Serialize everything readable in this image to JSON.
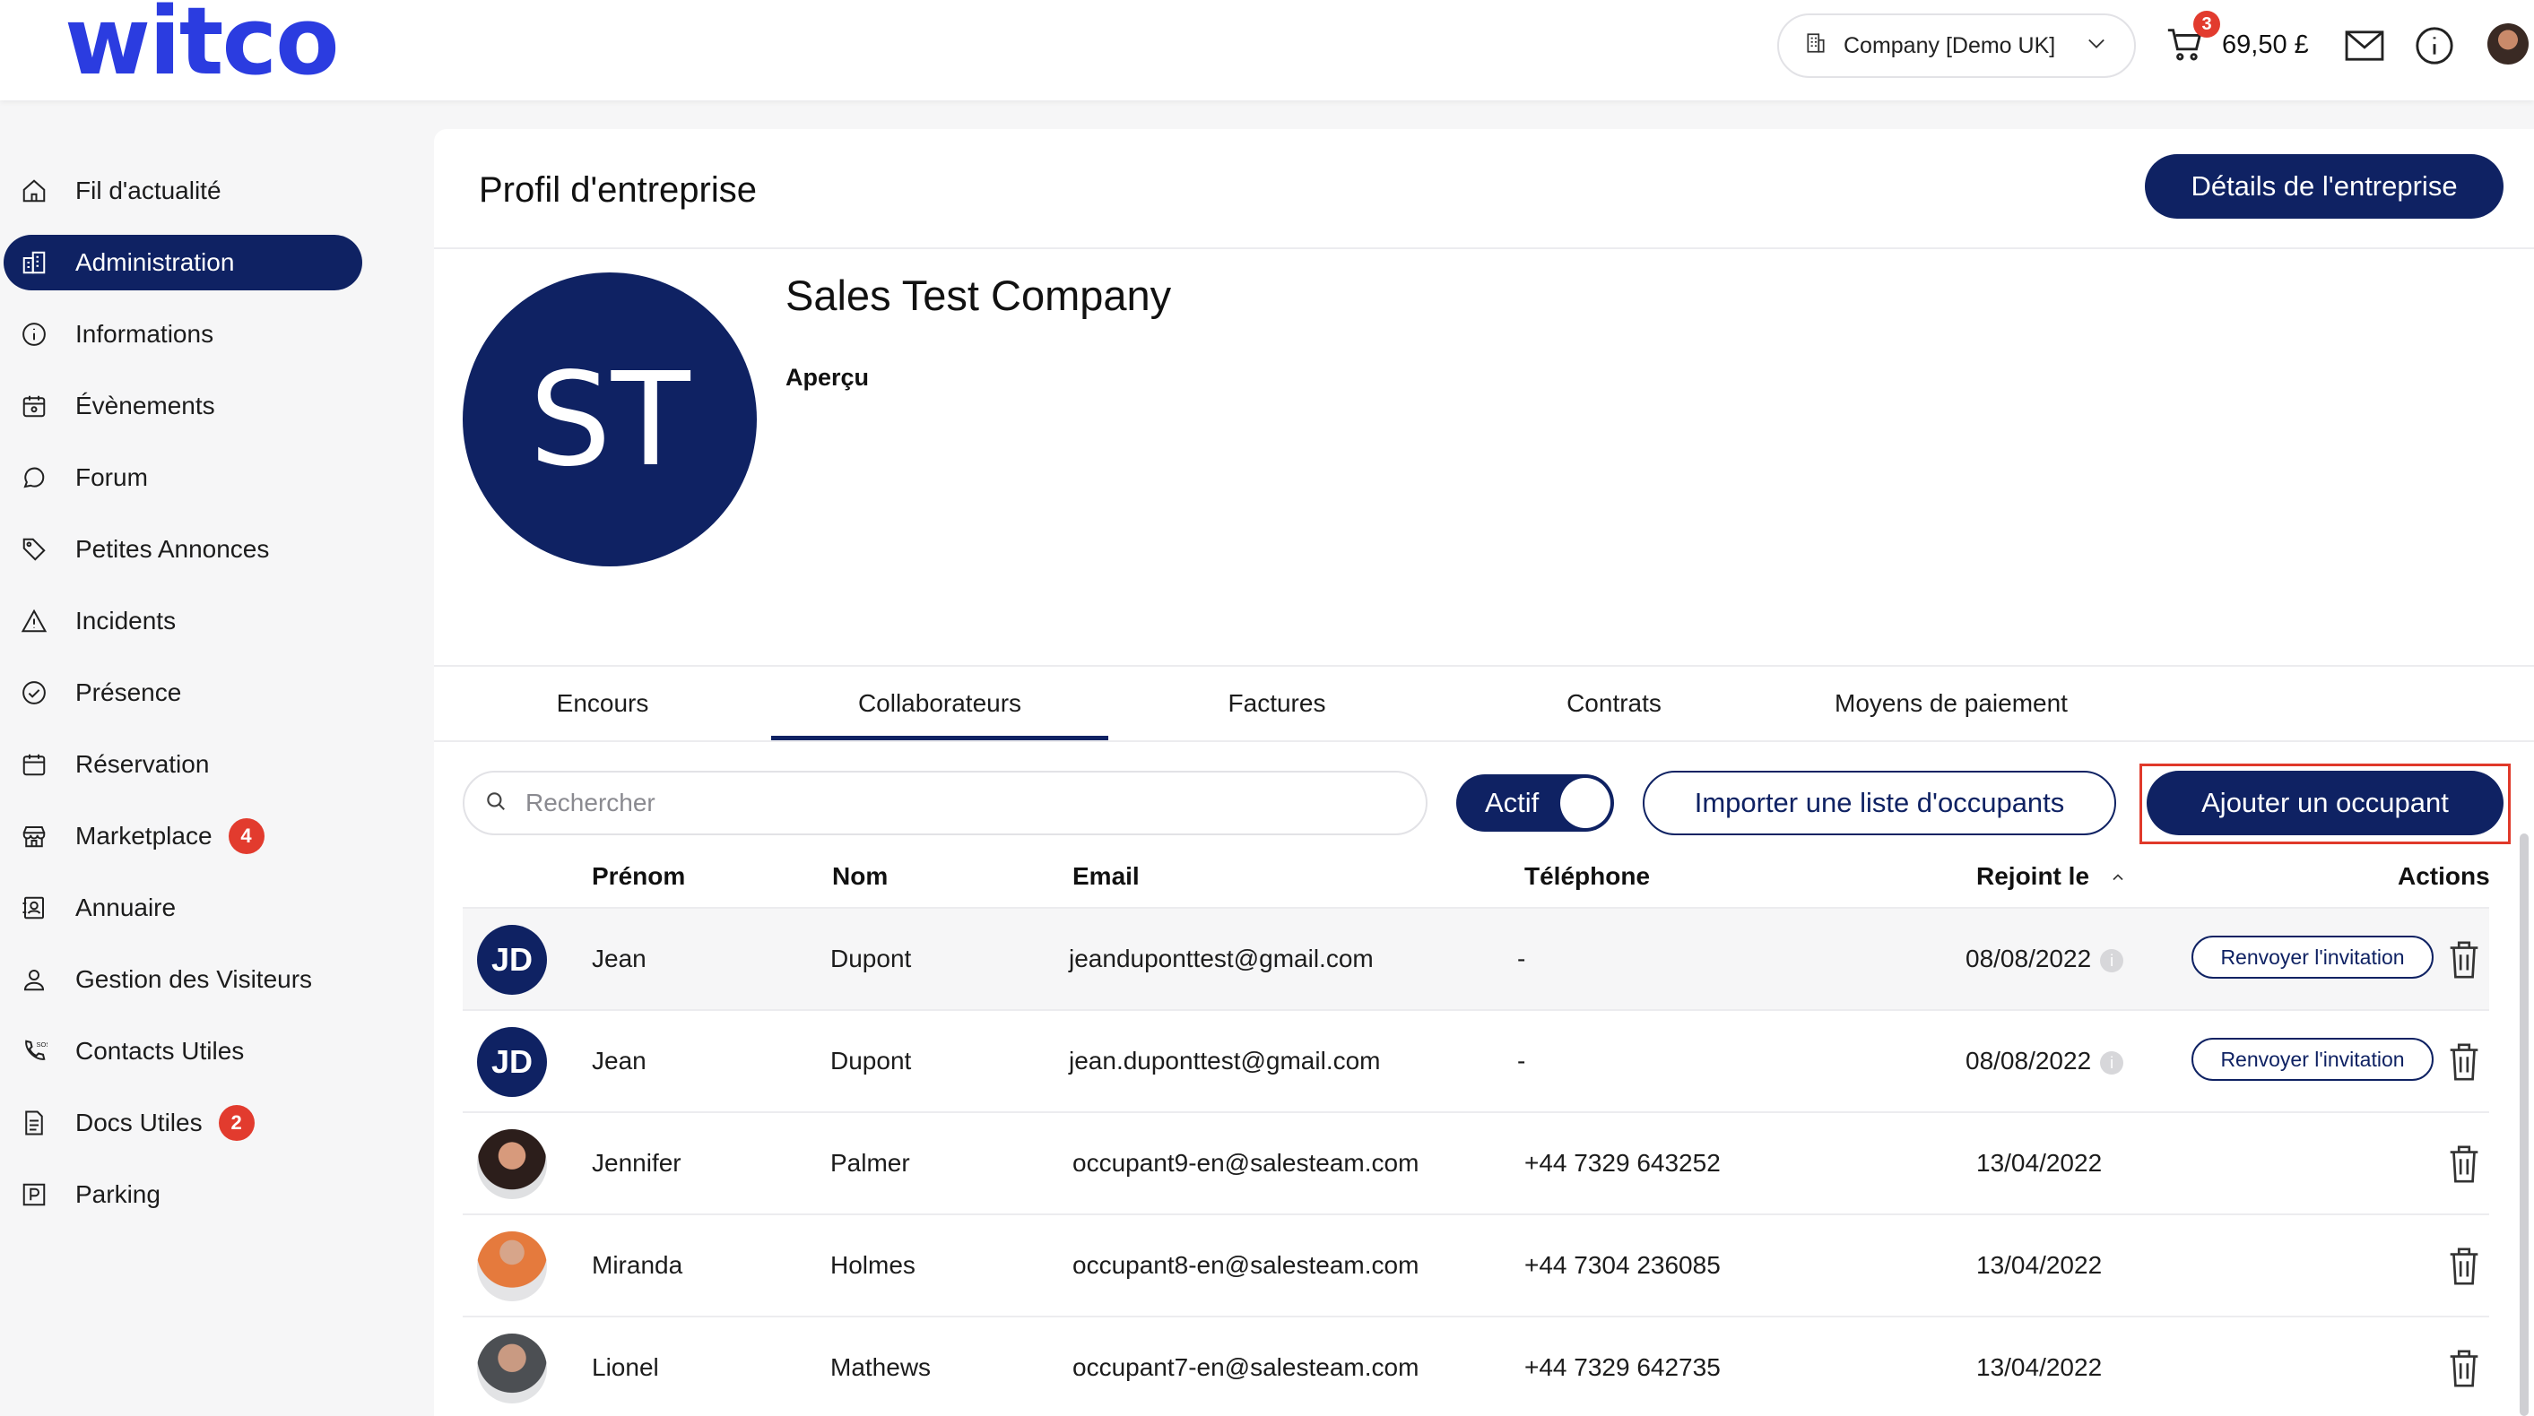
{
  "header": {
    "logo_text": "witco",
    "company_selector": "Company [Demo UK]",
    "cart_count": "3",
    "cart_amount": "69,50 £"
  },
  "sidebar": {
    "items": [
      {
        "label": "Fil d'actualité",
        "icon": "home-icon"
      },
      {
        "label": "Administration",
        "icon": "building-icon",
        "active": true
      },
      {
        "label": "Informations",
        "icon": "info-icon"
      },
      {
        "label": "Évènements",
        "icon": "calendar-event-icon"
      },
      {
        "label": "Forum",
        "icon": "chat-bubble-icon"
      },
      {
        "label": "Petites Annonces",
        "icon": "tag-icon"
      },
      {
        "label": "Incidents",
        "icon": "warning-icon"
      },
      {
        "label": "Présence",
        "icon": "check-circle-icon"
      },
      {
        "label": "Réservation",
        "icon": "calendar-icon"
      },
      {
        "label": "Marketplace",
        "icon": "store-icon",
        "badge": "4"
      },
      {
        "label": "Annuaire",
        "icon": "contact-book-icon"
      },
      {
        "label": "Gestion des Visiteurs",
        "icon": "visitor-icon"
      },
      {
        "label": "Contacts Utiles",
        "icon": "phone-sos-icon"
      },
      {
        "label": "Docs Utiles",
        "icon": "document-icon",
        "badge": "2"
      },
      {
        "label": "Parking",
        "icon": "parking-icon"
      }
    ]
  },
  "page": {
    "title": "Profil d'entreprise",
    "details_button": "Détails de l'entreprise",
    "company_initials": "ST",
    "company_name": "Sales Test Company",
    "overview_label": "Aperçu"
  },
  "tabs": [
    {
      "label": "Encours"
    },
    {
      "label": "Collaborateurs",
      "active": true
    },
    {
      "label": "Factures"
    },
    {
      "label": "Contrats"
    },
    {
      "label": "Moyens de paiement"
    }
  ],
  "toolbar": {
    "search_placeholder": "Rechercher",
    "toggle_label": "Actif",
    "import_button": "Importer une liste d'occupants",
    "add_button": "Ajouter un occupant"
  },
  "table": {
    "columns": [
      "Prénom",
      "Nom",
      "Email",
      "Téléphone",
      "Rejoint le",
      "Actions"
    ],
    "resend_label": "Renvoyer l'invitation",
    "rows": [
      {
        "initials": "JD",
        "first": "Jean",
        "last": "Dupont",
        "email": "jeanduponttest@gmail.com",
        "phone": "-",
        "joined": "08/08/2022"
      },
      {
        "initials": "JD",
        "first": "Jean",
        "last": "Dupont",
        "email": "jean.duponttest@gmail.com",
        "phone": "-",
        "joined": "08/08/2022"
      },
      {
        "initials": "",
        "first": "Jennifer",
        "last": "Palmer",
        "email": "occupant9-en@salesteam.com",
        "phone": "+44 7329 643252",
        "joined": "13/04/2022"
      },
      {
        "initials": "",
        "first": "Miranda",
        "last": "Holmes",
        "email": "occupant8-en@salesteam.com",
        "phone": "+44 7304 236085",
        "joined": "13/04/2022"
      },
      {
        "initials": "",
        "first": "Lionel",
        "last": "Mathews",
        "email": "occupant7-en@salesteam.com",
        "phone": "+44 7329 642735",
        "joined": "13/04/2022"
      }
    ]
  },
  "colors": {
    "brand_navy": "#0f2263",
    "logo_blue": "#2b3ce0",
    "badge_red": "#e23b2e"
  }
}
